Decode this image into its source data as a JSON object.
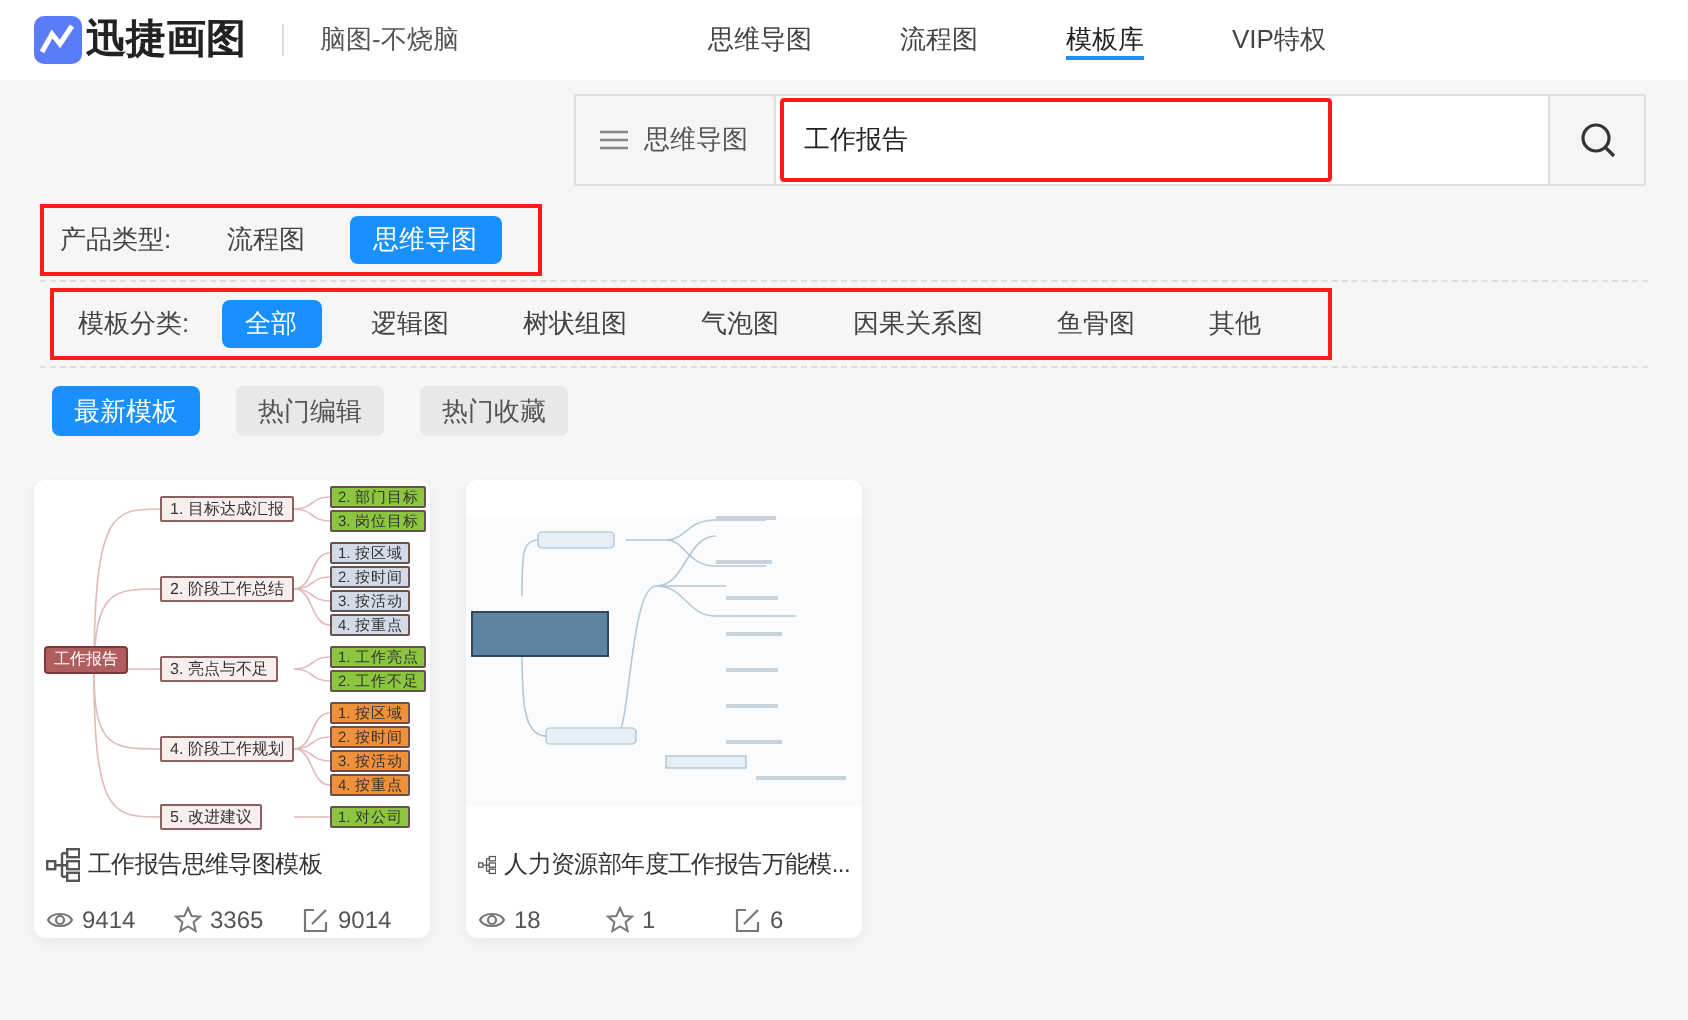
{
  "header": {
    "logo": "迅捷画图",
    "slogan": "脑图-不烧脑",
    "nav": [
      {
        "label": "思维导图",
        "selected": false
      },
      {
        "label": "流程图",
        "selected": false
      },
      {
        "label": "模板库",
        "selected": true
      },
      {
        "label": "VIP特权",
        "selected": false
      }
    ]
  },
  "search": {
    "category": "思维导图",
    "value": "工作报告",
    "highlighted": true
  },
  "filters": [
    {
      "label": "产品类型:",
      "highlighted": true,
      "options": [
        {
          "label": "流程图",
          "selected": false
        },
        {
          "label": "思维导图",
          "selected": true
        }
      ]
    },
    {
      "label": "模板分类:",
      "highlighted": true,
      "options": [
        {
          "label": "全部",
          "selected": true
        },
        {
          "label": "逻辑图",
          "selected": false
        },
        {
          "label": "树状组图",
          "selected": false
        },
        {
          "label": "气泡图",
          "selected": false
        },
        {
          "label": "因果关系图",
          "selected": false
        },
        {
          "label": "鱼骨图",
          "selected": false
        },
        {
          "label": "其他",
          "selected": false
        }
      ]
    }
  ],
  "sort_tabs": [
    {
      "label": "最新模板",
      "selected": true
    },
    {
      "label": "热门编辑",
      "selected": false
    },
    {
      "label": "热门收藏",
      "selected": false
    }
  ],
  "cards": [
    {
      "kind": "mindmap",
      "title": "工作报告思维导图模板",
      "views": "9414",
      "favorites": "3365",
      "edits": "9014",
      "preview": {
        "root": "工作报告",
        "branches": [
          {
            "label": "1. 目标达成汇报",
            "color": "#8cc63f",
            "children": [
              "2. 部门目标",
              "3. 岗位目标"
            ]
          },
          {
            "label": "2. 阶段工作总结",
            "color": "#d3dbe8",
            "children": [
              "1. 按区域",
              "2. 按时间",
              "3. 按活动",
              "4. 按重点"
            ]
          },
          {
            "label": "3. 亮点与不足",
            "color": "#8cc63f",
            "children": [
              "1. 工作亮点",
              "2. 工作不足"
            ]
          },
          {
            "label": "4. 阶段工作规划",
            "color": "#f0913a",
            "children": [
              "1. 按区域",
              "2. 按时间",
              "3. 按活动",
              "4. 按重点"
            ]
          },
          {
            "label": "5. 改进建议",
            "color": "#8cc63f",
            "children": [
              "1. 对公司"
            ]
          }
        ]
      }
    },
    {
      "kind": "picture",
      "title": "人力资源部年度工作报告万能模...",
      "views": "18",
      "favorites": "1",
      "edits": "6"
    }
  ]
}
